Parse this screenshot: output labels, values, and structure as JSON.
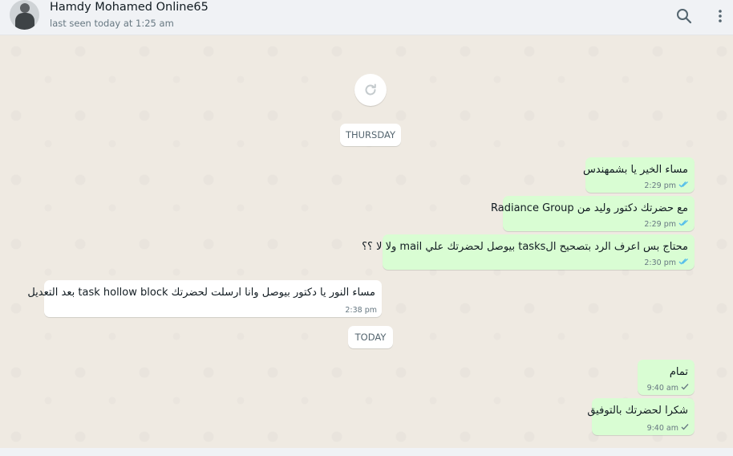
{
  "header": {
    "contact_name": "Hamdy Mohamed Online65",
    "last_seen": "last seen today at 1:25 am",
    "icons": {
      "search": "search-icon",
      "menu": "more-vertical-icon",
      "avatar": "contact-avatar"
    }
  },
  "chat": {
    "reload_icon": "refresh-icon",
    "dates": {
      "thursday": "THURSDAY",
      "today": "TODAY"
    },
    "messages": [
      {
        "direction": "outgoing",
        "text": "مساء الخير يا بشمهندس",
        "time": "2:29 pm",
        "status": "read"
      },
      {
        "direction": "outgoing",
        "text": "مع حضرتك دكتور وليد من Radiance Group",
        "time": "2:29 pm",
        "status": "read"
      },
      {
        "direction": "outgoing",
        "text": "محتاج بس اعرف الرد بتصحيح الtasks بيوصل لحضرتك علي mail ولا لا ؟؟",
        "time": "2:30 pm",
        "status": "read"
      },
      {
        "direction": "incoming",
        "text": "مساء النور يا دكتور بيوصل وانا ارسلت لحضرتك task hollow block بعد التعديل",
        "time": "2:38 pm"
      },
      {
        "direction": "outgoing",
        "text": "تمام",
        "time": "9:40 am",
        "status": "sent"
      },
      {
        "direction": "outgoing",
        "text": "شكرا لحضرتك بالتوفيق",
        "time": "9:40 am",
        "status": "sent"
      }
    ]
  },
  "colors": {
    "outgoing_bubble": "#d9fdd3",
    "incoming_bubble": "#ffffff",
    "read_tick": "#53bdeb",
    "sent_tick": "#667781",
    "chat_background": "#efeae2"
  }
}
